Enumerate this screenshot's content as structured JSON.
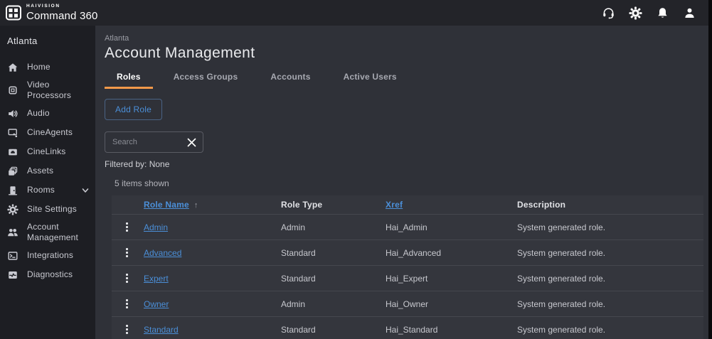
{
  "topbar": {
    "brand_small": "HAIVISION",
    "brand_large": "Command 360",
    "icons": [
      {
        "name": "support",
        "icon": "headset"
      },
      {
        "name": "settings",
        "icon": "gear"
      },
      {
        "name": "notifications",
        "icon": "bell"
      },
      {
        "name": "account",
        "icon": "person"
      }
    ]
  },
  "sidebar": {
    "site": "Atlanta",
    "items": [
      {
        "label": "Home",
        "icon": "home"
      },
      {
        "label": "Video Processors",
        "icon": "chip"
      },
      {
        "label": "Audio",
        "icon": "audio"
      },
      {
        "label": "CineAgents",
        "icon": "cineagents"
      },
      {
        "label": "CineLinks",
        "icon": "cinelinks"
      },
      {
        "label": "Assets",
        "icon": "assets"
      },
      {
        "label": "Rooms",
        "icon": "rooms",
        "chevron": true
      },
      {
        "label": "Site Settings",
        "icon": "gear"
      },
      {
        "label": "Account Management",
        "icon": "people"
      },
      {
        "label": "Integrations",
        "icon": "integrations"
      },
      {
        "label": "Diagnostics",
        "icon": "diagnostics"
      }
    ]
  },
  "main": {
    "breadcrumb": "Atlanta",
    "title": "Account Management",
    "tabs": [
      {
        "label": "Roles",
        "active": true
      },
      {
        "label": "Access Groups"
      },
      {
        "label": "Accounts"
      },
      {
        "label": "Active Users"
      }
    ],
    "add_button_label": "Add Role",
    "search": {
      "placeholder": "Search",
      "value": ""
    },
    "filtered_by": "Filtered by: None",
    "items_shown": "5 items shown",
    "table": {
      "columns": [
        {
          "label": "Role Name",
          "sortable": true,
          "sorted": "asc"
        },
        {
          "label": "Role Type"
        },
        {
          "label": "Xref",
          "sortable": true
        },
        {
          "label": "Description"
        }
      ],
      "sort_indicator": "↑",
      "rows": [
        {
          "role_name": "Admin",
          "role_type": "Admin",
          "xref": "Hai_Admin",
          "description": "System generated role."
        },
        {
          "role_name": "Advanced",
          "role_type": "Standard",
          "xref": "Hai_Advanced",
          "description": "System generated role."
        },
        {
          "role_name": "Expert",
          "role_type": "Standard",
          "xref": "Hai_Expert",
          "description": "System generated role."
        },
        {
          "role_name": "Owner",
          "role_type": "Admin",
          "xref": "Hai_Owner",
          "description": "System generated role."
        },
        {
          "role_name": "Standard",
          "role_type": "Standard",
          "xref": "Hai_Standard",
          "description": "System generated role."
        }
      ]
    }
  },
  "colors": {
    "accent_orange": "#f2994a",
    "link_blue": "#4b8fd8",
    "topbar_bg": "#232429",
    "sidebar_bg": "#1d1e23",
    "main_bg": "#2f3138",
    "row_bg": "#34363d"
  }
}
